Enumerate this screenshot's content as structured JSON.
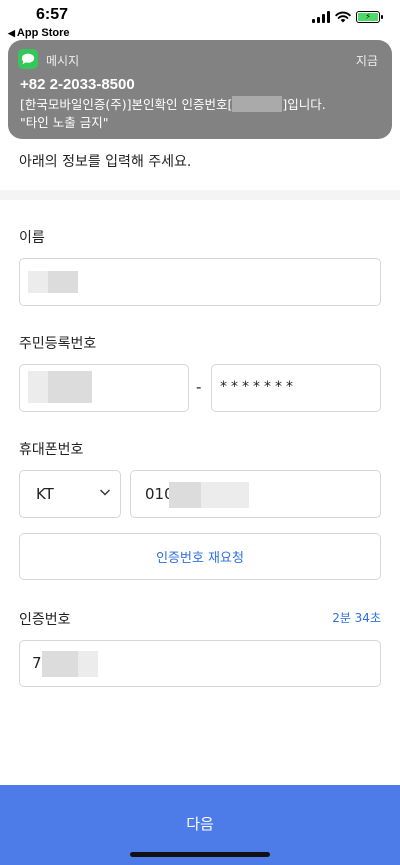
{
  "status_bar": {
    "time": "6:57",
    "back_app": "App Store",
    "back_arrow": "◀"
  },
  "notification": {
    "app_name": "메시지",
    "time": "지금",
    "sender": "+82 2-2033-8500",
    "body_prefix": "[한국모바일인증(주)]본인확인 인증번호[",
    "body_suffix": "]입니다.",
    "body_line2": "\"타인 노출 금지\"",
    "icon": "messages-icon",
    "icon_color": "#34c759"
  },
  "form": {
    "intro": "아래의 정보를 입력해 주세요.",
    "name": {
      "label": "이름"
    },
    "resident": {
      "label": "주민등록번호",
      "separator": "-",
      "back_masked": "*******"
    },
    "phone": {
      "label": "휴대폰번호",
      "carrier": "KT",
      "number_prefix": "010",
      "resend_label": "인증번호 재요청"
    },
    "code": {
      "label": "인증번호",
      "timer": "2분 34초",
      "value_prefix": "7"
    }
  },
  "next_button": "다음",
  "colors": {
    "accent": "#2f6fe4",
    "button_bg": "#4d7ce8"
  }
}
